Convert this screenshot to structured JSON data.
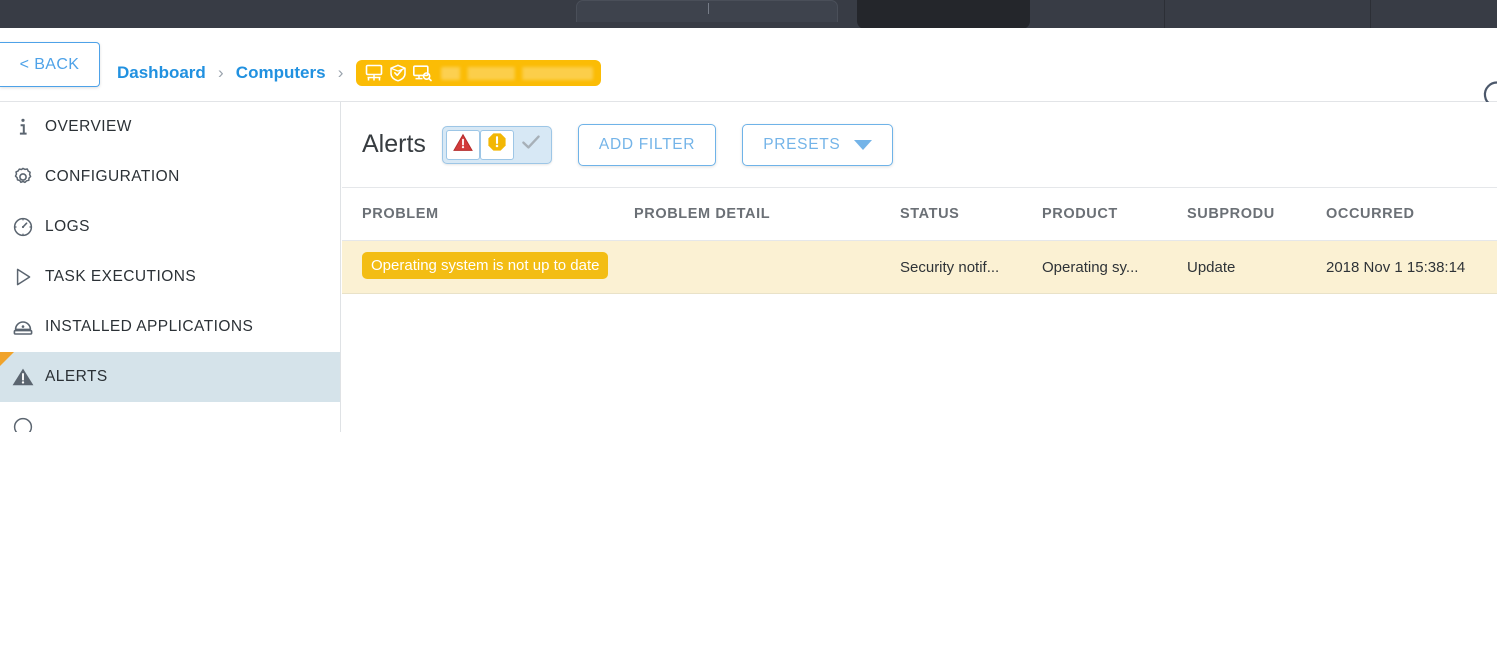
{
  "browser_chrome": {
    "omnibox_value": "",
    "active_tab_label": ""
  },
  "header": {
    "back_label": "< BACK",
    "breadcrumb": [
      {
        "label": "Dashboard",
        "type": "link"
      },
      {
        "label": "Computers",
        "type": "link"
      }
    ],
    "breadcrumb_separator": "›",
    "current_pill": {
      "label": "",
      "redacted": true,
      "color": "#fbbc05",
      "icons": [
        "network-computer-icon",
        "shield-check-icon",
        "monitor-search-icon"
      ]
    },
    "refresh_icon": "refresh-icon"
  },
  "sidebar": {
    "items": [
      {
        "label": "OVERVIEW",
        "icon": "info-icon",
        "selected": false
      },
      {
        "label": "CONFIGURATION",
        "icon": "gear-icon",
        "selected": false
      },
      {
        "label": "LOGS",
        "icon": "gauge-icon",
        "selected": false
      },
      {
        "label": "TASK EXECUTIONS",
        "icon": "play-icon",
        "selected": false
      },
      {
        "label": "INSTALLED APPLICATIONS",
        "icon": "applications-icon",
        "selected": false
      },
      {
        "label": "ALERTS",
        "icon": "warning-triangle-icon",
        "selected": true
      }
    ],
    "selected_accent_color": "#f0a32b",
    "selected_bg_color": "#d5e3ea"
  },
  "toolbar": {
    "title": "Alerts",
    "severity_filters": [
      {
        "name": "warning-red",
        "icon": "warning-triangle-red-icon",
        "active": true
      },
      {
        "name": "warning-yellow",
        "icon": "exclamation-octagon-yellow-icon",
        "active": true
      },
      {
        "name": "ok-check",
        "icon": "check-icon",
        "active": false
      }
    ],
    "add_filter_label": "ADD FILTER",
    "presets_label": "PRESETS"
  },
  "table": {
    "columns": [
      {
        "key": "problem",
        "label": "PROBLEM"
      },
      {
        "key": "detail",
        "label": "PROBLEM DETAIL"
      },
      {
        "key": "status",
        "label": "STATUS"
      },
      {
        "key": "product",
        "label": "PRODUCT"
      },
      {
        "key": "subproduct",
        "label": "SUBPRODU"
      },
      {
        "key": "occurred",
        "label": "OCCURRED"
      }
    ],
    "rows": [
      {
        "problem": "Operating system is not up to date",
        "problem_pill_color": "#f3bd14",
        "detail": "",
        "status": "Security notif...",
        "product": "Operating sy...",
        "subproduct": "Update",
        "occurred": "2018 Nov 1 15:38:14",
        "row_bg_color": "#fbf1d3"
      }
    ]
  }
}
